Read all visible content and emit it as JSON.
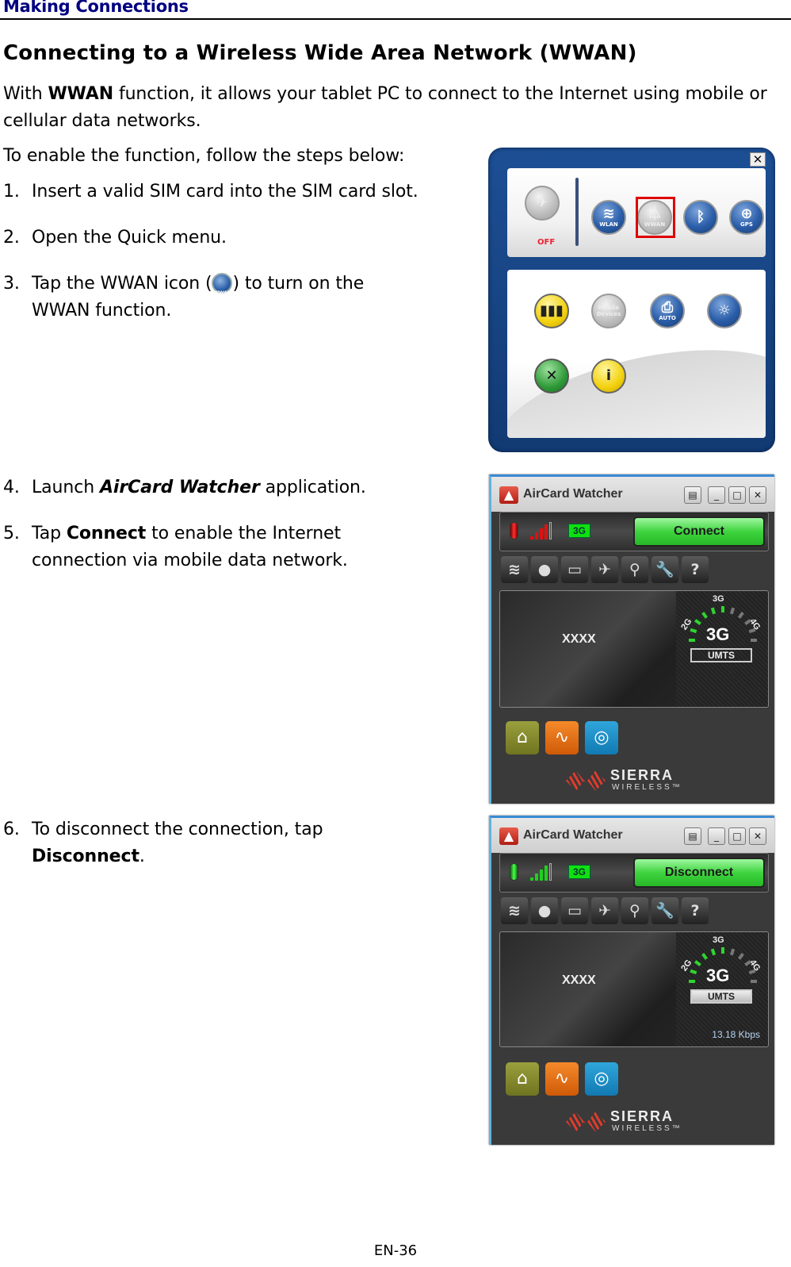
{
  "header": {
    "section": "Making Connections",
    "title": "Connecting to a Wireless Wide Area Network (WWAN)"
  },
  "intro": {
    "prefix": "With ",
    "bold": "WWAN",
    "suffix": " function, it allows your tablet PC to connect to the Internet using mobile or cellular data networks."
  },
  "steps_intro": "To enable the function, follow the steps below:",
  "steps": [
    {
      "num": "1.",
      "text": "Insert a valid SIM card into the SIM card slot."
    },
    {
      "num": "2.",
      "text": "Open the Quick menu."
    },
    {
      "num": "3.",
      "line1_pre": "Tap the WWAN icon (",
      "line1_post": ") to turn on the",
      "line2": "WWAN function.",
      "icon_label": "WWAN"
    },
    {
      "num": "4.",
      "pre": "Launch ",
      "emph": "AirCard Watcher",
      "post": " application."
    },
    {
      "num": "5.",
      "pre": "Tap ",
      "bold": "Connect",
      "post": " to enable the Internet",
      "line2": "connection via mobile data network."
    },
    {
      "num": "6.",
      "line1": "To disconnect the connection, tap",
      "bold": "Disconnect",
      "post": "."
    }
  ],
  "quick_menu": {
    "close": "✕",
    "top_row": [
      {
        "name": "airplane",
        "label": "",
        "state": "off",
        "status_text": "OFF"
      },
      {
        "name": "wlan",
        "label": "WLAN",
        "state": "on"
      },
      {
        "name": "wwan",
        "label": "WWAN",
        "state": "off",
        "highlighted": true
      },
      {
        "name": "bluetooth",
        "label": "",
        "state": "on"
      },
      {
        "name": "gps",
        "label": "GPS",
        "state": "on"
      }
    ],
    "bottom_row1": [
      {
        "name": "battery",
        "label": ""
      },
      {
        "name": "mobile-devices",
        "label": "Mobile Devices"
      },
      {
        "name": "auto-rotate",
        "label": "AUTO"
      },
      {
        "name": "brightness",
        "label": ""
      }
    ],
    "bottom_row2": [
      {
        "name": "settings",
        "label": ""
      },
      {
        "name": "info",
        "label": "i"
      }
    ]
  },
  "aircard_windows": [
    {
      "title": "AirCard Watcher",
      "led": "red",
      "signal_color": "#e01010",
      "network_badge": "3G",
      "button": "Connect",
      "tools": [
        "wifi",
        "sms",
        "sim",
        "airplane",
        "satellite",
        "settings",
        "help"
      ],
      "carrier": "XXXX",
      "gauge": {
        "top": "3G",
        "left": "2G",
        "right": "4G",
        "current": "3G",
        "tech": "UMTS"
      },
      "speed": "",
      "apps": [
        "home",
        "monitor",
        "help"
      ],
      "brand": {
        "name": "SIERRA",
        "sub": "WIRELESS™"
      }
    },
    {
      "title": "AirCard Watcher",
      "led": "green",
      "signal_color": "#20d020",
      "network_badge": "3G",
      "button": "Disconnect",
      "tools": [
        "wifi",
        "sms",
        "sim",
        "airplane",
        "satellite",
        "settings",
        "help"
      ],
      "carrier": "XXXX",
      "gauge": {
        "top": "3G",
        "left": "2G",
        "right": "4G",
        "current": "3G",
        "tech": "UMTS"
      },
      "speed": "13.18 Kbps",
      "apps": [
        "home",
        "monitor",
        "help"
      ],
      "brand": {
        "name": "SIERRA",
        "sub": "WIRELESS™"
      }
    }
  ],
  "glyphs": {
    "wifi": "≋",
    "sms": "●",
    "sim": "▭",
    "airplane": "✈",
    "satellite": "⚲",
    "settings": "🔧",
    "help": "?",
    "home": "⌂",
    "monitor": "∿",
    "lifebuoy": "◎",
    "window_menu": "▤",
    "minimize": "_",
    "maximize": "□",
    "close": "✕"
  },
  "footer": {
    "page": "EN-36"
  }
}
